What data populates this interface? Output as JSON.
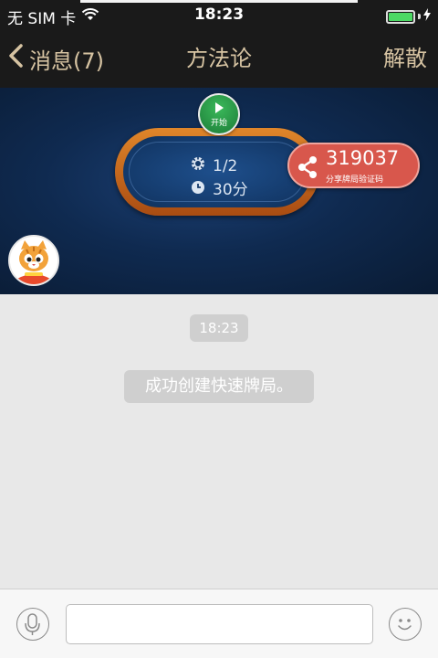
{
  "status_bar": {
    "carrier": "无 SIM 卡",
    "time": "18:23",
    "battery_color": "#4cd964"
  },
  "nav": {
    "back_label": "消息(7)",
    "title": "方法论",
    "right_action": "解散",
    "accent_color": "#d6c3a2"
  },
  "table": {
    "start_label": "开始",
    "players": "1/2",
    "duration": "30分",
    "share": {
      "code": "319037",
      "caption": "分享牌局验证码"
    }
  },
  "chat": {
    "timestamp": "18:23",
    "system_message": "成功创建快速牌局。"
  },
  "input_bar": {
    "text_value": "",
    "voice_icon": "microphone-icon",
    "emoji_icon": "smiley-icon"
  }
}
